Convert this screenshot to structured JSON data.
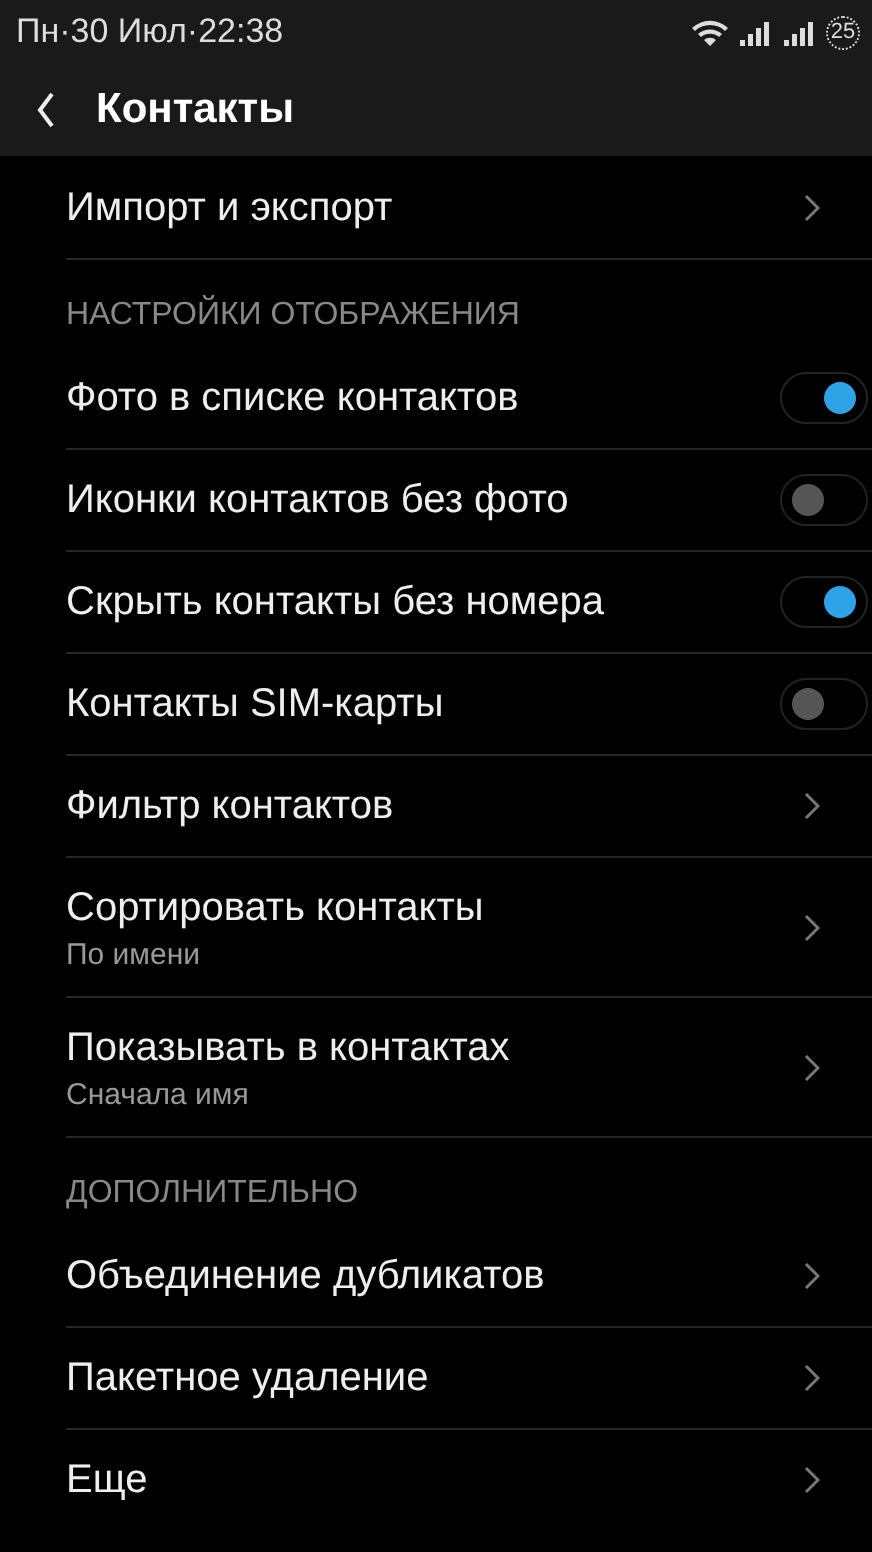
{
  "status_bar": {
    "time": "Пн·30 Июл·22:38",
    "battery": "25"
  },
  "header": {
    "title": "Контакты"
  },
  "items": [
    {
      "kind": "link",
      "label": "Импорт и экспорт"
    },
    {
      "kind": "section",
      "label": "НАСТРОЙКИ ОТОБРАЖЕНИЯ"
    },
    {
      "kind": "toggle",
      "label": "Фото в списке контактов",
      "on": true
    },
    {
      "kind": "toggle",
      "label": "Иконки контактов без фото",
      "on": false
    },
    {
      "kind": "toggle",
      "label": "Скрыть контакты без номера",
      "on": true
    },
    {
      "kind": "toggle",
      "label": "Контакты SIM-карты",
      "on": false
    },
    {
      "kind": "link",
      "label": "Фильтр контактов"
    },
    {
      "kind": "link",
      "label": "Сортировать контакты",
      "subtitle": "По имени"
    },
    {
      "kind": "link",
      "label": "Показывать в контактах",
      "subtitle": "Сначала имя"
    },
    {
      "kind": "section",
      "label": "ДОПОЛНИТЕЛЬНО"
    },
    {
      "kind": "link",
      "label": "Объединение дубликатов"
    },
    {
      "kind": "link",
      "label": "Пакетное удаление"
    },
    {
      "kind": "link",
      "label": "Еще"
    }
  ]
}
